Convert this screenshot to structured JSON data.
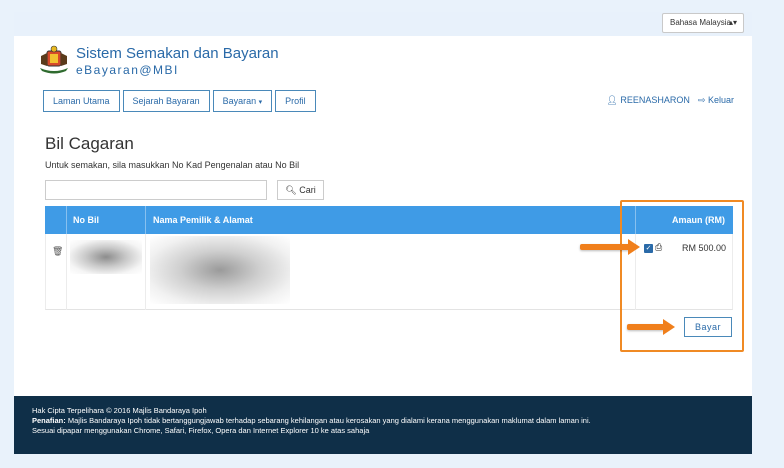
{
  "language_selector": {
    "value": "Bahasa Malaysia"
  },
  "header": {
    "title": "Sistem Semakan dan Bayaran",
    "subtitle": "eBayaran@MBI"
  },
  "nav": {
    "items": [
      {
        "label": "Laman Utama"
      },
      {
        "label": "Sejarah Bayaran"
      },
      {
        "label": "Bayaran"
      },
      {
        "label": "Profil"
      }
    ]
  },
  "user": {
    "name": "REENASHARON",
    "logout_label": "Keluar"
  },
  "page": {
    "title": "Bil Cagaran",
    "instruction": "Untuk semakan, sila masukkan No Kad Pengenalan atau No Bil"
  },
  "search": {
    "value": "",
    "button_label": "Cari"
  },
  "table": {
    "headers": {
      "no_bil": "No Bil",
      "nama": "Nama Pemilik & Alamat",
      "amaun": "Amaun (RM)"
    },
    "rows": [
      {
        "amount": "RM 500.00",
        "checked": true
      }
    ]
  },
  "pay_button": {
    "label": "Bayar"
  },
  "footer": {
    "copyright": "Hak Cipta Terpelihara © 2016 Majlis Bandaraya Ipoh",
    "disclaimer_label": "Penafian:",
    "disclaimer_text": "Majlis Bandaraya Ipoh tidak bertanggungjawab terhadap sebarang kehilangan atau kerosakan yang dialami kerana menggunakan maklumat dalam laman ini.",
    "browsers": "Sesuai dipapar menggunakan Chrome, Safari, Firefox, Opera dan Internet Explorer 10 ke atas sahaja"
  },
  "colors": {
    "accent": "#2a6aa8",
    "table_header": "#3f9be6",
    "footer": "#0f2f48",
    "highlight": "#f08a24"
  }
}
